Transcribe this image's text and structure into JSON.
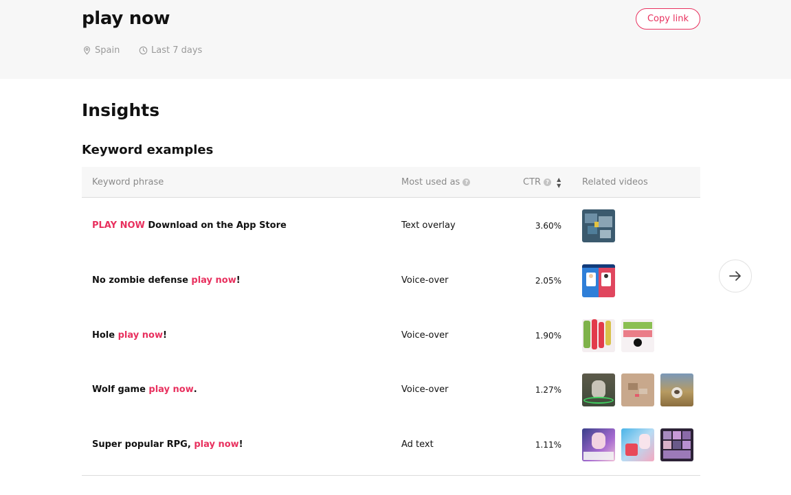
{
  "header": {
    "keyword": "play now",
    "copy_link_label": "Copy link",
    "location": "Spain",
    "period": "Last 7 days"
  },
  "insights": {
    "title": "Insights",
    "section_title": "Keyword examples"
  },
  "table": {
    "columns": {
      "phrase": "Keyword phrase",
      "used_as": "Most used as",
      "ctr": "CTR",
      "videos": "Related videos"
    },
    "rows": [
      {
        "pre": "",
        "hl": "PLAY NOW",
        "post": " Download on the App Store",
        "used_as": "Text overlay",
        "ctr": "3.60%",
        "videos": [
          "office-game-thumbnail"
        ]
      },
      {
        "pre": "No zombie defense ",
        "hl": "play now",
        "post": "!",
        "used_as": "Voice-over",
        "ctr": "2.05%",
        "videos": [
          "choose-good-bad-guy-thumbnail"
        ]
      },
      {
        "pre": "Hole ",
        "hl": "play now",
        "post": "!",
        "used_as": "Voice-over",
        "ctr": "1.90%",
        "videos": [
          "hole-game-thumbnail-1",
          "hole-game-thumbnail-2"
        ]
      },
      {
        "pre": "Wolf game ",
        "hl": "play now",
        "post": ".",
        "used_as": "Voice-over",
        "ctr": "1.27%",
        "videos": [
          "wolf-game-thumbnail-1",
          "wolf-game-thumbnail-2",
          "wolf-game-thumbnail-3"
        ]
      },
      {
        "pre": "Super popular RPG, ",
        "hl": "play now",
        "post": "!",
        "used_as": "Ad text",
        "ctr": "1.11%",
        "videos": [
          "rpg-thumbnail-1",
          "rpg-thumbnail-2",
          "rpg-thumbnail-3"
        ]
      }
    ]
  },
  "colors": {
    "accent": "#e8305e",
    "header_bg": "#f7f7f7"
  },
  "icons": {
    "location": "location-pin-icon",
    "clock": "clock-icon",
    "info": "info-icon",
    "sort": "sort-icon",
    "next": "arrow-right-icon"
  }
}
